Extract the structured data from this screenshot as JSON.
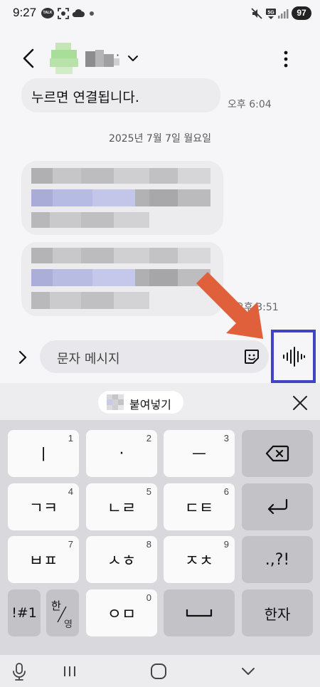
{
  "status_bar": {
    "time": "9:27",
    "talk_icon_text": "TALK",
    "battery": "97"
  },
  "messages": {
    "bubble1_text": "누르면 연결됩니다.",
    "bubble1_time": "오후 6:04",
    "date_separator": "2025년 7월 7일 월요일",
    "bubble3_time_partial": "오후 3:51"
  },
  "input": {
    "placeholder": "문자 메시지"
  },
  "keyboard": {
    "paste_label": "붙여넣기",
    "keys": [
      {
        "name": "key-1",
        "label": "ㅣ",
        "num": "1"
      },
      {
        "name": "key-2",
        "label": "·",
        "num": "2"
      },
      {
        "name": "key-3",
        "label": "ㅡ",
        "num": "3"
      },
      {
        "name": "key-4",
        "label": "ㄱㅋ",
        "num": "4"
      },
      {
        "name": "key-5",
        "label": "ㄴㄹ",
        "num": "5"
      },
      {
        "name": "key-6",
        "label": "ㄷㅌ",
        "num": "6"
      },
      {
        "name": "key-7",
        "label": "ㅂㅍ",
        "num": "7"
      },
      {
        "name": "key-8",
        "label": "ㅅㅎ",
        "num": "8"
      },
      {
        "name": "key-9",
        "label": "ㅈㅊ",
        "num": "9"
      },
      {
        "name": "key-punct",
        "label": ".,?!",
        "num": ""
      },
      {
        "name": "key-symbols",
        "label": "!#1",
        "num": ""
      },
      {
        "name": "key-0",
        "label": "ㅇㅁ",
        "num": "0"
      },
      {
        "name": "key-hanja",
        "label": "한자",
        "num": ""
      }
    ],
    "lang_key_top": "한",
    "lang_key_bottom": "영"
  },
  "colors": {
    "highlight_box": "#3f43c4",
    "annotation_arrow": "#e0603c",
    "bubble": "#ececef"
  },
  "icons": [
    "back-arrow-icon",
    "chevron-down-icon",
    "more-vertical-icon",
    "expand-chevron-icon",
    "emoji-sticker-icon",
    "voice-wave-icon",
    "backspace-icon",
    "enter-icon",
    "space-icon",
    "close-icon",
    "mic-icon",
    "recents-icon",
    "home-icon",
    "back-nav-icon"
  ]
}
